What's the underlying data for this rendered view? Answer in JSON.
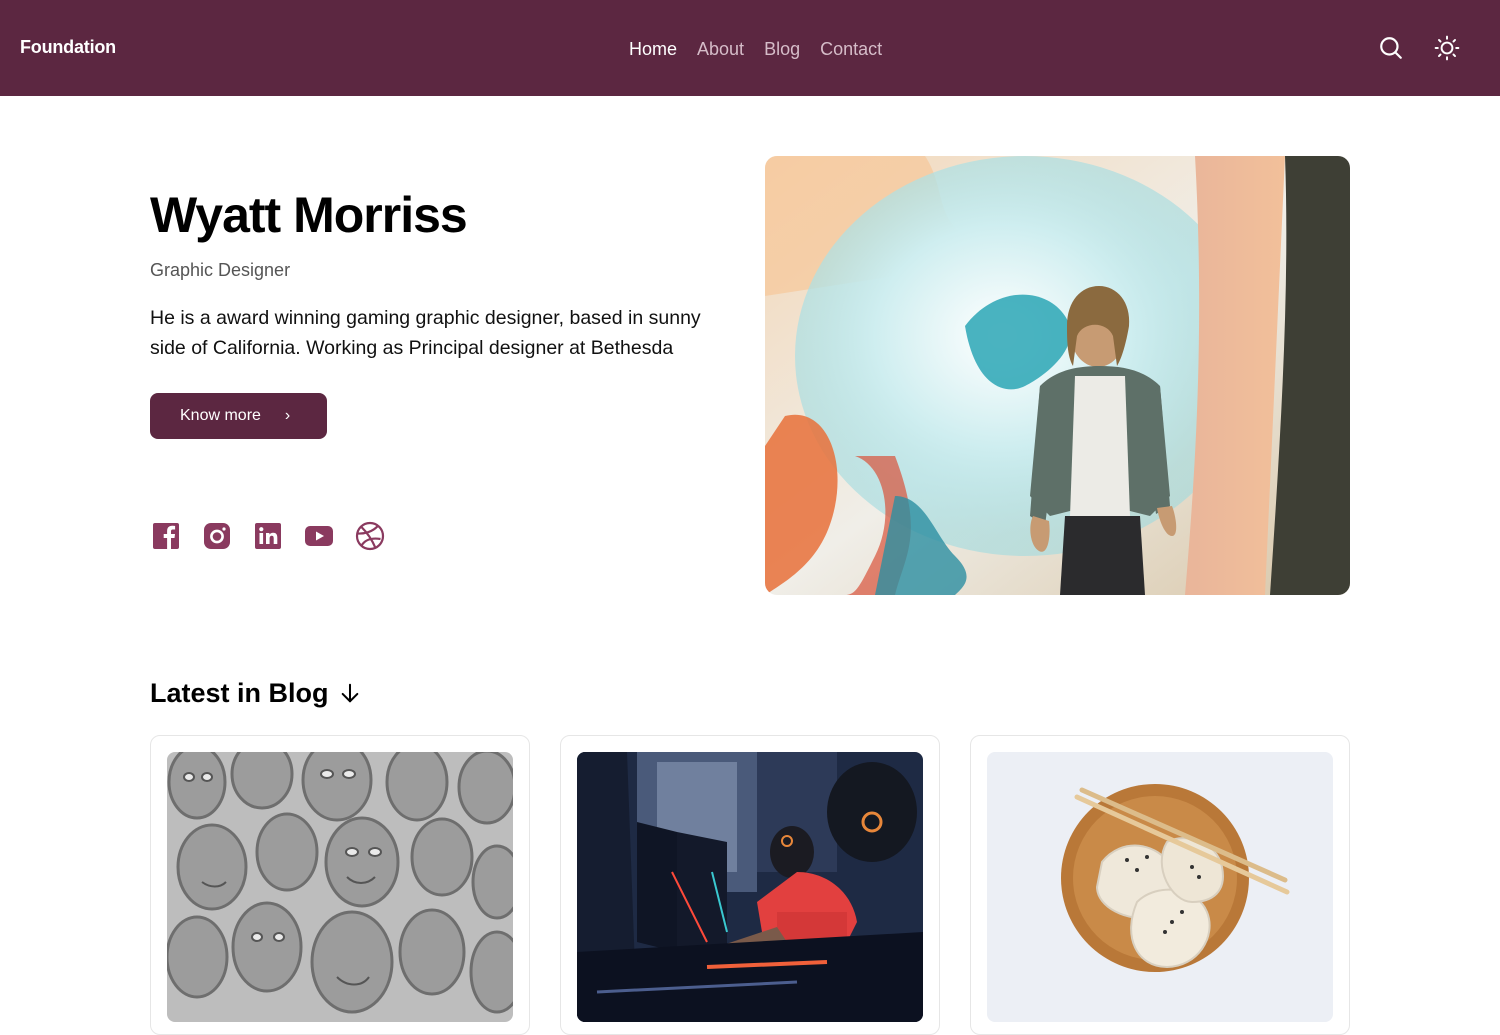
{
  "header": {
    "brand": "Foundation",
    "nav": [
      {
        "label": "Home",
        "active": true
      },
      {
        "label": "About",
        "active": false
      },
      {
        "label": "Blog",
        "active": false
      },
      {
        "label": "Contact",
        "active": false
      }
    ],
    "icons": [
      "search-icon",
      "sun-icon"
    ]
  },
  "hero": {
    "name": "Wyatt Morriss",
    "role": "Graphic Designer",
    "bio": "He is a award winning gaming graphic designer, based in sunny side of California. Working as Principal designer at Bethesda",
    "cta_label": "Know more",
    "socials": [
      "facebook-icon",
      "instagram-icon",
      "linkedin-icon",
      "youtube-icon",
      "dribbble-icon"
    ]
  },
  "blog": {
    "heading": "Latest in Blog"
  },
  "colors": {
    "brand": "#5c2741",
    "icon": "#8a3a5f",
    "nav_inactive": "#d5bcc8"
  }
}
